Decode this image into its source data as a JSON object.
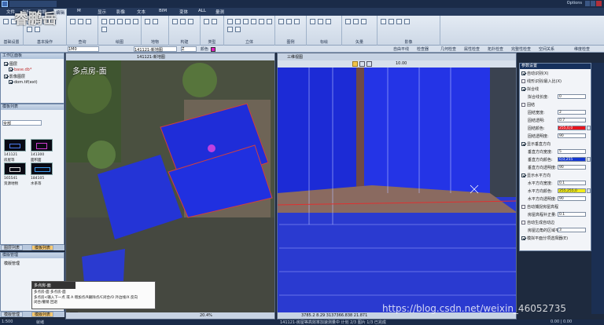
{
  "titlebar": {
    "options": "Options"
  },
  "menu": [
    "文件",
    "坐标",
    "数据",
    "编辑",
    "M",
    "显示",
    "影像",
    "文本",
    "BIM",
    "变体",
    "ALL",
    "量测"
  ],
  "ribbon": {
    "groups": [
      "基础设置",
      "基本操作",
      "查询",
      "绘图",
      "地物",
      "构建",
      "类型",
      "立体",
      "图例",
      "标绘",
      "矢量",
      "影像"
    ]
  },
  "toolbar2": {
    "left_dd": "1M0",
    "mid_dd": "141121-新地图",
    "layer_label": "图层",
    "obj_dd": "Z",
    "color_label": "颜色",
    "right_items": [
      "自由平线",
      "检查器",
      "几何检查",
      "属性检查",
      "拓扑检查",
      "完整性检查",
      "空间关系",
      "空间关系",
      "维度检查"
    ]
  },
  "leftpanel1": {
    "title": "工作区面板",
    "items": [
      "图层",
      "影像图层"
    ],
    "sub1": "base.db*",
    "sub2": "dom.tif(ext)"
  },
  "leftpanel2": {
    "title": "模板列表",
    "filter": "全部",
    "thumbs": [
      {
        "code": "141121",
        "name": "房屋等"
      },
      {
        "code": "141300",
        "name": "面积面"
      },
      {
        "code": "165541",
        "name": "资源地物"
      },
      {
        "code": "184105",
        "name": "水系等"
      }
    ]
  },
  "leftpanel3": {
    "title": "模版管理",
    "subtitle": "模版管理"
  },
  "tabs": {
    "left_top": [
      "图层列表",
      "模板列表"
    ],
    "left_bottom": [
      "模版管理",
      "模版列表"
    ]
  },
  "orthoview": {
    "title": "141121-新地图",
    "label": "多点房-面",
    "zoom": "20.4%"
  },
  "view3d": {
    "title": "三维视图",
    "coords": "3785.2 8.29  3137366.838  21.871",
    "zoom": "10.00"
  },
  "tooltip": {
    "title": "多点房-面",
    "lines": [
      "多点房-面 多点房-面",
      "多点房<输入下一点 或 A 增加点/R删除点/C闭合/O 外边线/X 反向",
      "闭合/撤销 回退"
    ]
  },
  "properties": {
    "title": "参数设置",
    "rows": [
      {
        "label": "自动识别(X)",
        "checked": true
      },
      {
        "label": "线形识别/最入比(X)",
        "checked": false
      },
      {
        "label": "拟合线",
        "checked": true,
        "section": true
      },
      {
        "label": "拟合线长度:",
        "value": "0"
      },
      {
        "label": "固结",
        "checked": false
      },
      {
        "label": "固结宽度:",
        "value": "2"
      },
      {
        "label": "固结透明:",
        "value": "0.7"
      },
      {
        "label": "固结颜色:",
        "value": "255,0,0",
        "color": "#e8141c"
      },
      {
        "label": "固结透明度:",
        "value": "90"
      },
      {
        "label": "显示垂直方向",
        "checked": true,
        "section": true
      },
      {
        "label": "垂直方向宽度:",
        "value": "5"
      },
      {
        "label": "垂直方向颜色:",
        "value": "0,0,255",
        "color": "#1437d0"
      },
      {
        "label": "垂直方向透明度:",
        "value": "90"
      },
      {
        "label": "显示水平方向",
        "checked": true,
        "section": true
      },
      {
        "label": "水平方向宽度:",
        "value": "0.1"
      },
      {
        "label": "水平方向颜色:",
        "value": "255,255,0",
        "color": "#f2ec1a"
      },
      {
        "label": "水平方向透明度:",
        "value": "90"
      },
      {
        "label": "自动捕捉房屋高程",
        "checked": false,
        "section": true
      },
      {
        "label": "房屋高程补正量:",
        "value": "0.1"
      },
      {
        "label": "自动生成自动边",
        "checked": false,
        "section": true
      },
      {
        "label": "房屋边角的区域平滑(检测):",
        "value": "3"
      },
      {
        "label": "模拟平面分项选择器(E)",
        "checked": true
      }
    ]
  },
  "statusbar": {
    "left": "1:500",
    "mid1": "就绪",
    "mid2": "141121-房屋等高效率加速测量中 计划 2/3  图片 1/3 已完成",
    "right": "0.00  |  0.00"
  },
  "watermark": "https://blog.csdn.net/weixin_46052735",
  "logo": "睿鹏岳",
  "colors": {
    "roof_blue": "#2a3df0",
    "accent": "#f6c870",
    "titlebar": "#1a2b48"
  }
}
